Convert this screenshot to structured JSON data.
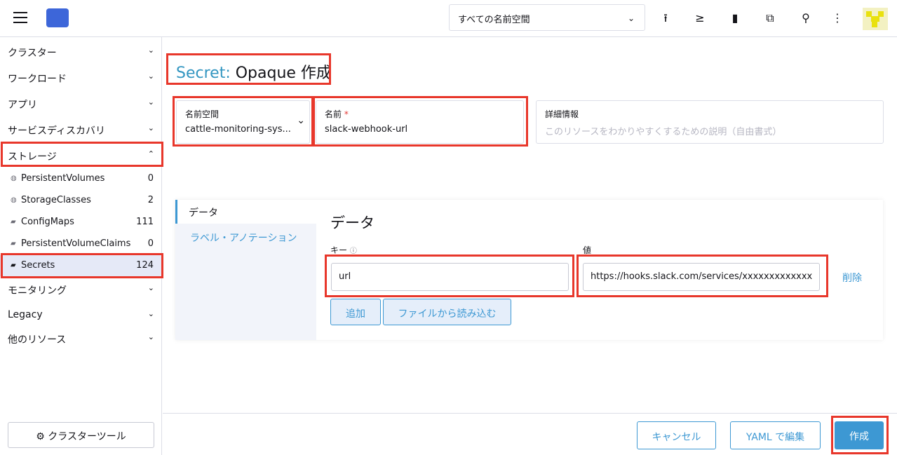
{
  "header": {
    "namespace_select": "すべての名前空間",
    "icons": [
      "upload-icon",
      "terminal-icon",
      "file-icon",
      "copy-icon",
      "search-icon",
      "more-vert-icon"
    ]
  },
  "sidebar": {
    "groups": [
      {
        "label": "クラスター",
        "open": false
      },
      {
        "label": "ワークロード",
        "open": false
      },
      {
        "label": "アプリ",
        "open": false
      },
      {
        "label": "サービスディスカバリ",
        "open": false
      },
      {
        "label": "ストレージ",
        "open": true
      }
    ],
    "storage_items": [
      {
        "label": "PersistentVolumes",
        "count": "0",
        "icon": "globe-icon"
      },
      {
        "label": "StorageClasses",
        "count": "2",
        "icon": "globe-icon"
      },
      {
        "label": "ConfigMaps",
        "count": "111",
        "icon": "folder-icon"
      },
      {
        "label": "PersistentVolumeClaims",
        "count": "0",
        "icon": "folder-icon"
      },
      {
        "label": "Secrets",
        "count": "124",
        "icon": "folder-icon",
        "active": true
      }
    ],
    "groups_after": [
      {
        "label": "モニタリング"
      },
      {
        "label": "Legacy"
      },
      {
        "label": "他のリソース"
      }
    ],
    "cluster_tools": "クラスターツール"
  },
  "main": {
    "title_prefix": "Secret:",
    "title_rest": "Opaque 作成",
    "namespace": {
      "label": "名前空間",
      "value": "cattle-monitoring-sys..."
    },
    "name": {
      "label": "名前",
      "required_mark": "*",
      "value": "slack-webhook-url"
    },
    "description": {
      "label": "詳細情報",
      "placeholder": "このリソースをわかりやすくするための説明（自由書式）"
    },
    "tabs": [
      {
        "label": "データ",
        "active": true
      },
      {
        "label": "ラベル・アノテーション",
        "active": false
      }
    ],
    "data_heading": "データ",
    "key_label": "キー",
    "value_label": "値",
    "key_value": "url",
    "value_value": "https://hooks.slack.com/services/xxxxxxxxxxxxx",
    "delete_label": "削除",
    "add_label": "追加",
    "read_file_label": "ファイルから読み込む"
  },
  "footer": {
    "cancel": "キャンセル",
    "yaml_edit": "YAML で編集",
    "create": "作成"
  },
  "colors": {
    "accent": "#3d98d3",
    "highlight": "#e8372b",
    "title_accent": "#3396c1"
  }
}
